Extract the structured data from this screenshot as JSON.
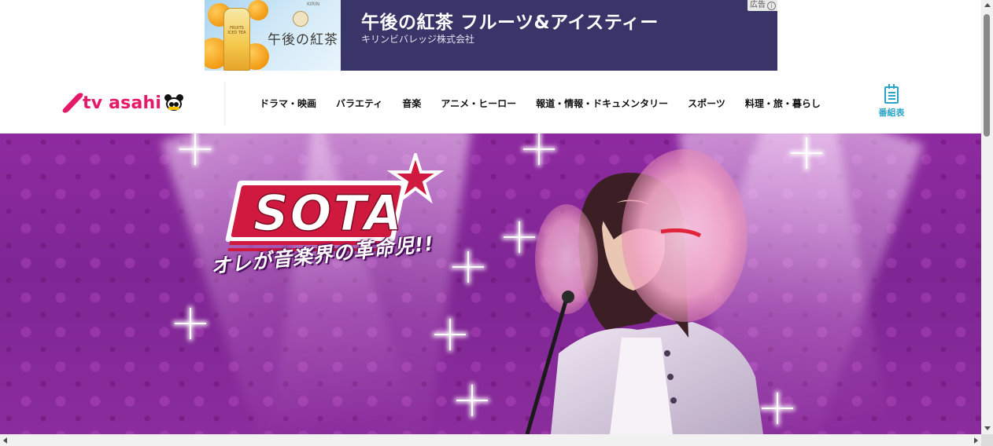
{
  "ad": {
    "title": "午後の紅茶 フルーツ&アイスティー",
    "sponsor": "キリンビバレッジ株式会社",
    "badge": "広告",
    "image_copy": "午後の紅茶",
    "bottle_label": "FRUITS ICED TEA",
    "maker_tiny": "KIRIN",
    "colors": {
      "background": "#3a3568"
    }
  },
  "header": {
    "logo_text": "tv asahi",
    "nav": [
      {
        "label": "ドラマ・映画"
      },
      {
        "label": "バラエティ"
      },
      {
        "label": "音楽"
      },
      {
        "label": "アニメ・ヒーロー"
      },
      {
        "label": "報道・情報・ドキュメンタリー"
      },
      {
        "label": "スポーツ"
      },
      {
        "label": "料理・旅・暮らし"
      }
    ],
    "schedule_label": "番組表",
    "colors": {
      "brand": "#e5196a",
      "schedule": "#2aa5c8"
    }
  },
  "hero": {
    "show_title": "SOTA",
    "tagline": "オレが音楽界の革命児!!",
    "colors": {
      "background": "#8e2aa0",
      "logo_red": "#d0193f"
    }
  },
  "icons": {
    "ad_info": "info-icon",
    "schedule": "schedule-icon",
    "logo_mascot": "panda-icon",
    "hero_star": "star-icon"
  }
}
